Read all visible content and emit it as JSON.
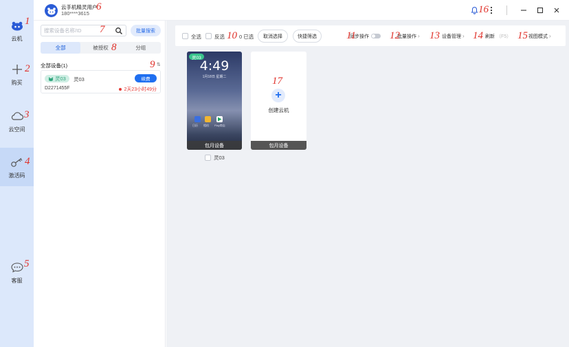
{
  "nav": {
    "items": [
      {
        "label": "云机",
        "icon": "cloud-phone-icon"
      },
      {
        "label": "购买",
        "icon": "plus-icon"
      },
      {
        "label": "云空间",
        "icon": "cloud-icon"
      },
      {
        "label": "激活码",
        "icon": "key-icon"
      },
      {
        "label": "客服",
        "icon": "chat-bubble-icon"
      }
    ],
    "numbers": [
      "1",
      "2",
      "3",
      "4",
      "5"
    ]
  },
  "header": {
    "user_name": "云手机精灵用户",
    "phone": "180****3615",
    "num_user": "6",
    "num_bell": "16"
  },
  "sidebar": {
    "search_placeholder": "搜索设备名称/ID",
    "num_search": "7",
    "batch_search": "批量搜索",
    "tabs": [
      "全部",
      "被授权",
      "分组"
    ],
    "num_tabs": "8",
    "group_title": "全部设备(1)",
    "num_sort": "9",
    "device": {
      "tag": "灵03",
      "name": "灵03",
      "renew": "续费",
      "id": "D2271455F",
      "remaining": "2天23小时49分"
    }
  },
  "toolbar": {
    "select_all": "全选",
    "invert": "反选",
    "num_invert": "10",
    "selected": "0 已选",
    "cancel": "取消选择",
    "quick_filter": "快捷筛选",
    "sync": "同步操作",
    "num_sync": "11",
    "batch": "批量操作",
    "num_batch": "12",
    "device_mgmt": "设备管理",
    "num_mgmt": "13",
    "refresh": "刷新",
    "refresh_key": "（F5）",
    "num_refresh": "14",
    "view_mode": "视图模式",
    "num_view": "15"
  },
  "grid": {
    "phone": {
      "tag": "灵03",
      "time": "4:49",
      "date": "1月18日 星期二",
      "footer": "包月设备",
      "select_label": "灵03",
      "apps": [
        "日历",
        "相机",
        "Play商店"
      ]
    },
    "create": {
      "num": "17",
      "label": "创建云机",
      "footer": "包月设备"
    }
  },
  "colors": {
    "accent": "#1f6ff0",
    "nav_bg": "#dce8fb",
    "annotation": "#e0322b"
  }
}
